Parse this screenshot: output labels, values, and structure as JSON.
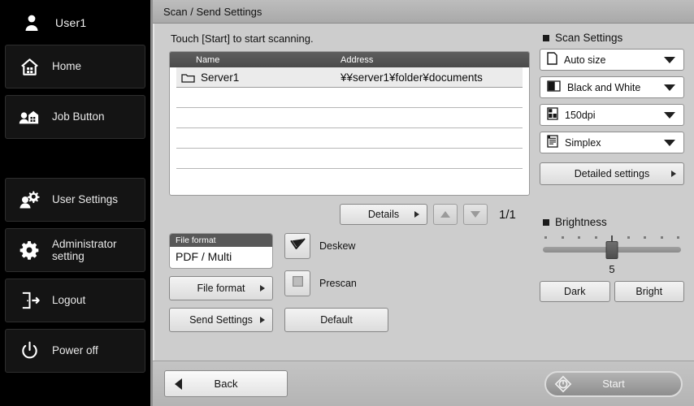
{
  "sidebar": {
    "user": {
      "label": "User1",
      "icon": "user-icon"
    },
    "items": [
      {
        "label": "Home",
        "icon": "home-icon"
      },
      {
        "label": "Job Button",
        "icon": "job-button-icon"
      },
      {
        "label": "User Settings",
        "icon": "user-settings-icon"
      },
      {
        "label": "Administrator\nsetting",
        "icon": "gear-icon"
      },
      {
        "label": "Logout",
        "icon": "logout-icon"
      },
      {
        "label": "Power off",
        "icon": "power-icon"
      }
    ]
  },
  "titlebar": {
    "title": "Scan / Send Settings"
  },
  "main": {
    "hint": "Touch [Start] to start scanning.",
    "table": {
      "columns": [
        "Name",
        "Address"
      ],
      "rows": [
        {
          "name": "Server1",
          "address": "¥¥server1¥folder¥documents",
          "icon": "folder-icon"
        }
      ],
      "empty_row_count": 5
    },
    "details_button": "Details",
    "page_indicator": "1/1",
    "nav_up": "scroll-up",
    "nav_down": "scroll-down",
    "file_format_box": {
      "caption": "File format",
      "value": "PDF / Multi"
    },
    "file_format_button": "File format",
    "send_settings_button": "Send Settings",
    "deskew": {
      "label": "Deskew",
      "icon": "check-icon",
      "checked": true
    },
    "prescan": {
      "label": "Prescan",
      "icon": "square-icon",
      "checked": false
    },
    "default_button": "Default"
  },
  "scan_settings": {
    "title": "Scan Settings",
    "options": [
      {
        "label": "Auto size",
        "icon": "paper-size-icon"
      },
      {
        "label": "Black and White",
        "icon": "color-mode-icon"
      },
      {
        "label": "150dpi",
        "icon": "resolution-icon"
      },
      {
        "label": "Simplex",
        "icon": "duplex-icon"
      }
    ],
    "detailed_settings_button": "Detailed settings"
  },
  "brightness": {
    "title": "Brightness",
    "value": "5",
    "tick_count": 9,
    "dark_button": "Dark",
    "bright_button": "Bright"
  },
  "bottom": {
    "back_button": "Back",
    "start_button": "Start",
    "start_icon": "start-diamond-icon"
  },
  "colors": {
    "sidebar_bg": "#000000",
    "panel_bg": "#cdcdcd",
    "titlebar": "#b5b5b5",
    "table_header": "#4f4f4f",
    "accent_text": "#111111"
  }
}
